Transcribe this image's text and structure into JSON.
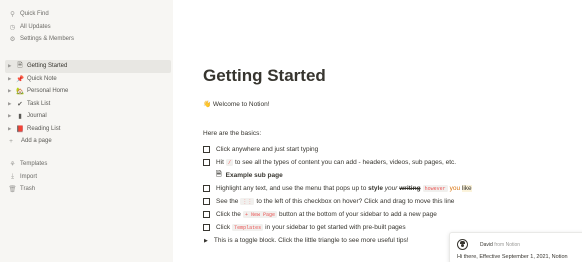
{
  "sidebar": {
    "top": [
      {
        "icon": "search-icon",
        "glyph": "⚲",
        "label": "Quick Find"
      },
      {
        "icon": "clock-icon",
        "glyph": "◷",
        "label": "All Updates"
      },
      {
        "icon": "gear-icon",
        "glyph": "⚙",
        "label": "Settings & Members"
      }
    ],
    "pages": [
      {
        "icon": "page-icon",
        "glyph": "🗎",
        "label": "Getting Started"
      },
      {
        "icon": "pin-icon",
        "glyph": "📌",
        "label": "Quick Note"
      },
      {
        "icon": "house-icon",
        "glyph": "🏡",
        "label": "Personal Home"
      },
      {
        "icon": "checkmark-icon",
        "glyph": "✔",
        "label": "Task List"
      },
      {
        "icon": "journal-icon",
        "glyph": "▮",
        "label": "Journal"
      },
      {
        "icon": "books-icon",
        "glyph": "📕",
        "label": "Reading List"
      }
    ],
    "add_page": {
      "glyph": "+",
      "label": "Add a page"
    },
    "bottom": [
      {
        "icon": "templates-icon",
        "glyph": "⚘",
        "label": "Templates"
      },
      {
        "icon": "import-icon",
        "glyph": "⤓",
        "label": "Import"
      },
      {
        "icon": "trash-icon",
        "glyph": "🗑",
        "label": "Trash"
      }
    ]
  },
  "page": {
    "title": "Getting Started",
    "welcome_emoji": "👋",
    "welcome": "Welcome to Notion!",
    "basics": "Here are the basics:",
    "todos": {
      "t1": "Click anywhere and just start typing",
      "t2_a": "Hit",
      "t2_code": "/",
      "t2_b": "to see all the types of content you can add - headers, videos, sub pages, etc.",
      "sub_page": "Example sub page",
      "t3_a": "Highlight any text, and use the menu that pops up to",
      "t3_style": "style",
      "t3_your": "your",
      "t3_writing": "writing",
      "t3_however": "however",
      "t3_you": "you",
      "t3_like": "like",
      "t4_a": "See the",
      "t4_code": "⋮⋮",
      "t4_b": "to the left of this checkbox on hover? Click and drag to move this line",
      "t5_a": "Click the",
      "t5_code": "+ New Page",
      "t5_b": "button at the bottom of your sidebar to add a new page",
      "t6_a": "Click",
      "t6_code": "Templates",
      "t6_b": "in your sidebar to get started with pre-built pages"
    },
    "toggle": "This is a toggle block. Click the little triangle to see more useful tips!"
  },
  "notification": {
    "sender": "David",
    "source": "from Notion",
    "message": "Hi there, Effective September 1, 2021, Notion"
  },
  "colors": {
    "sidebar_bg": "#f7f6f3",
    "code_text": "#eb5757",
    "orange": "#d9730d",
    "highlight": "#fbf3db"
  }
}
